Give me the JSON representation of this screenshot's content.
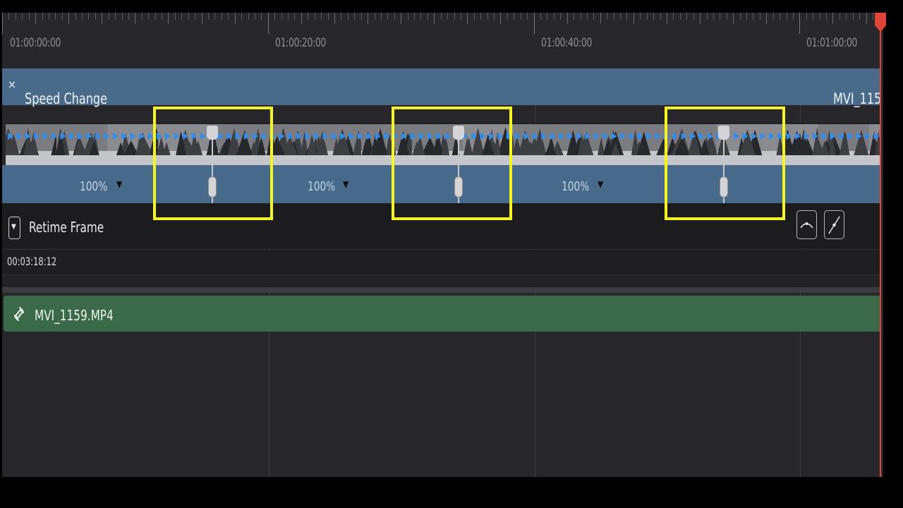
{
  "ruler": {
    "timecodes": [
      "01:00:00:00",
      "01:00:20:00",
      "01:00:40:00",
      "01:01:00:00"
    ]
  },
  "speed_change_clip": {
    "close_glyph": "×",
    "title": "Speed Change",
    "clip_name": "MVI_115",
    "segments": [
      {
        "speed": "100%",
        "arrow": "▼"
      },
      {
        "speed": "100%",
        "arrow": "▼"
      },
      {
        "speed": "100%",
        "arrow": "▼"
      }
    ],
    "speed_points_highlighted": 3
  },
  "retime": {
    "dropdown_glyph": "▼",
    "label": "Retime Frame",
    "timecode": "00:03:18:12",
    "curve_buttons": [
      "ease-curve-icon",
      "linear-curve-icon"
    ]
  },
  "audio_clip": {
    "icon": "link-icon",
    "name": "MVI_1159.MP4"
  },
  "colors": {
    "speed_clip": "#4a6a8a",
    "audio_clip": "#3a6a49",
    "highlight": "#f5f523",
    "playhead": "#e0453a",
    "speed_arrows": "#2f8ff0"
  }
}
